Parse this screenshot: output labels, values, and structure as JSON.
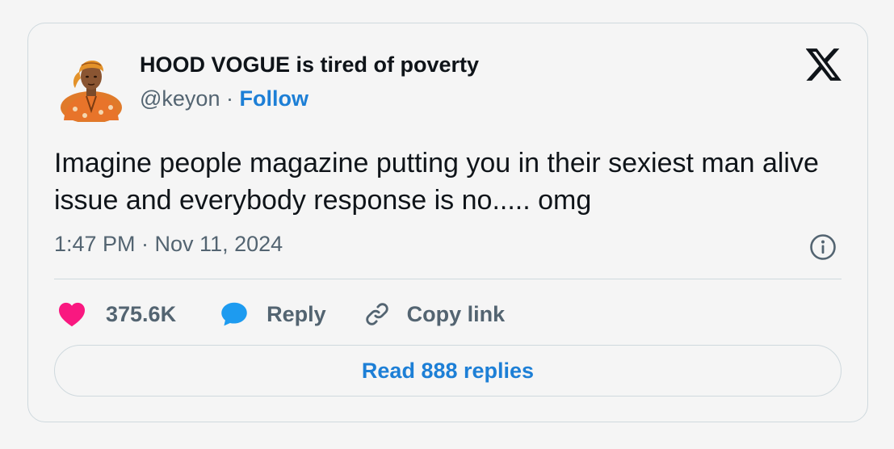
{
  "author": {
    "display_name": "HOOD VOGUE is tired of poverty",
    "handle": "@keyon",
    "separator": " · ",
    "follow_label": "Follow",
    "avatar_icon": "avatar-illustration-icon"
  },
  "tweet": {
    "text": "Imagine people magazine putting you in their sexiest man alive issue and everybody response is no..... omg",
    "timestamp": "1:47 PM · Nov 11, 2024"
  },
  "actions": {
    "like_count": "375.6K",
    "reply_label": "Reply",
    "copy_label": "Copy link"
  },
  "read_replies_label": "Read 888 replies",
  "icons": {
    "logo": "x-logo-icon",
    "info": "info-icon",
    "like": "heart-icon",
    "reply": "speech-bubble-icon",
    "copy": "link-icon"
  },
  "colors": {
    "accent": "#1d7fd6",
    "like": "#f91880",
    "text": "#0f1419",
    "muted": "#536471",
    "border": "#cfd9de"
  }
}
